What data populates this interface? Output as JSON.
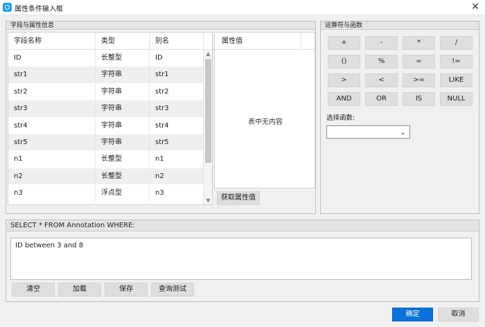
{
  "window": {
    "title": "属性条件输入框",
    "close_glyph": "✕"
  },
  "fields_group": {
    "title": "字段与属性信息",
    "columns": [
      "字段名称",
      "类型",
      "别名"
    ],
    "rows": [
      [
        "ID",
        "长整型",
        "ID"
      ],
      [
        "str1",
        "字符串",
        "str1"
      ],
      [
        "str2",
        "字符串",
        "str2"
      ],
      [
        "str3",
        "字符串",
        "str3"
      ],
      [
        "str4",
        "字符串",
        "str4"
      ],
      [
        "str5",
        "字符串",
        "str5"
      ],
      [
        "n1",
        "长整型",
        "n1"
      ],
      [
        "n2",
        "长整型",
        "n2"
      ],
      [
        "n3",
        "浮点型",
        "n3"
      ]
    ],
    "attr_header": "属性值",
    "attr_empty": "表中无内容",
    "get_values_button": "获取属性值"
  },
  "operators_group": {
    "title": "运算符与函数",
    "buttons": [
      "+",
      "-",
      "*",
      "/",
      "()",
      "%",
      "=",
      "!=",
      ">",
      "<",
      ">=",
      "LIKE",
      "AND",
      "OR",
      "IS",
      "NULL"
    ],
    "function_label": "选择函数:",
    "function_value": ""
  },
  "query_group": {
    "title": "SELECT * FROM Annotation WHERE:",
    "expression": "ID between 3 and 8",
    "buttons": {
      "clear": "清空",
      "load": "加载",
      "save": "保存",
      "test": "查询测试"
    }
  },
  "footer": {
    "ok": "确定",
    "cancel": "取消"
  },
  "colors": {
    "primary": "#0a72d8",
    "app_icon": "#1e9be8"
  }
}
